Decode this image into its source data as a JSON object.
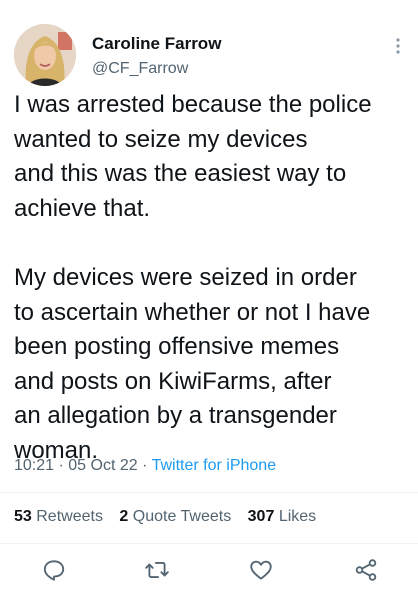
{
  "author": {
    "display_name": "Caroline Farrow",
    "handle": "@CF_Farrow",
    "avatar_icon": "profile-photo"
  },
  "tweet": {
    "paragraphs": [
      "I was arrested because the police\nwanted to seize my devices\nand this was the easiest way to\nachieve that.",
      "My devices were seized in order\nto ascertain whether or not I have\nbeen posting offensive memes\nand posts on KiwiFarms, after\nan allegation by a transgender\nwoman."
    ]
  },
  "meta": {
    "time": "10:21",
    "separator": "·",
    "date": "05 Oct 22",
    "source": "Twitter for iPhone"
  },
  "stats": {
    "retweets": {
      "count": "53",
      "label": "Retweets"
    },
    "quote_tweets": {
      "count": "2",
      "label": "Quote Tweets"
    },
    "likes": {
      "count": "307",
      "label": "Likes"
    }
  },
  "actions": [
    "reply-icon",
    "retweet-icon",
    "like-icon",
    "share-icon"
  ],
  "colors": {
    "text": "#0f1419",
    "secondary": "#536471",
    "link": "#1d9bf0",
    "divider": "#eff3f4"
  }
}
